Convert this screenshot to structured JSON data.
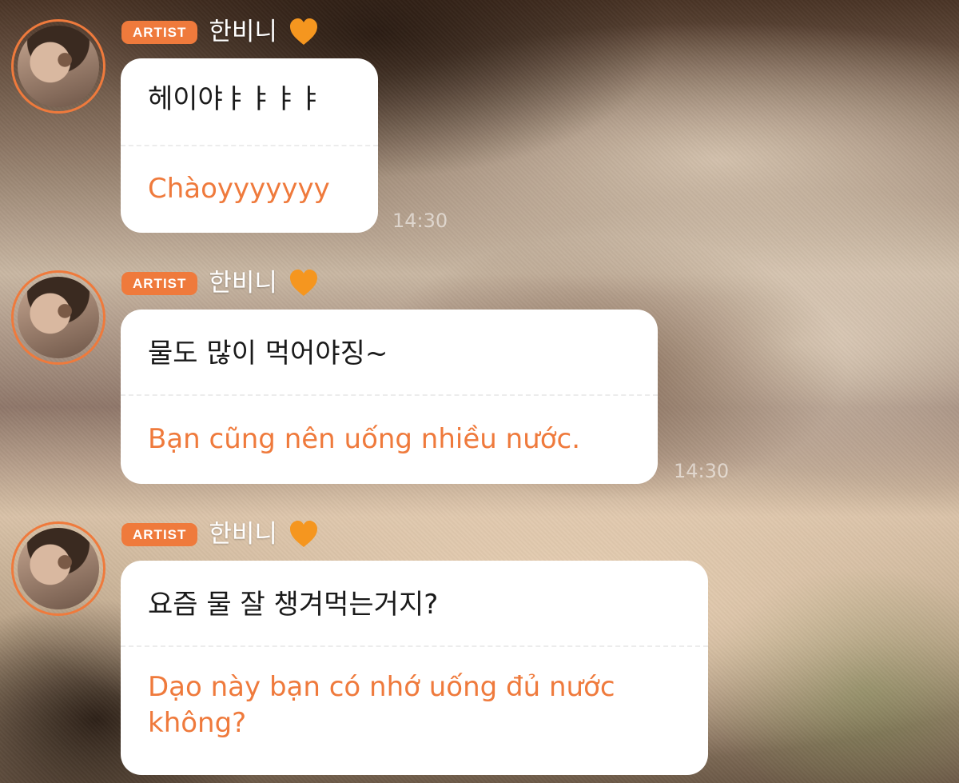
{
  "messages": [
    {
      "badge": "ARTIST",
      "author": "한비니",
      "original": "헤이야ㅑㅑㅑㅑ",
      "translation": "Chàoyyyyyyy",
      "time": "14:30"
    },
    {
      "badge": "ARTIST",
      "author": "한비니",
      "original": "물도 많이 먹어야징~",
      "translation": "Bạn cũng nên uống nhiều nước.",
      "time": "14:30"
    },
    {
      "badge": "ARTIST",
      "author": "한비니",
      "original": "요즘 물 잘 챙겨먹는거지?",
      "translation": "Dạo này bạn có nhớ uống đủ nước không?",
      "time": ""
    }
  ],
  "icons": {
    "heart": "orange-heart-icon",
    "avatar": "artist-avatar"
  },
  "colors": {
    "accent": "#ef7a3c",
    "bubble": "#ffffff",
    "text": "#1a1a1a"
  }
}
